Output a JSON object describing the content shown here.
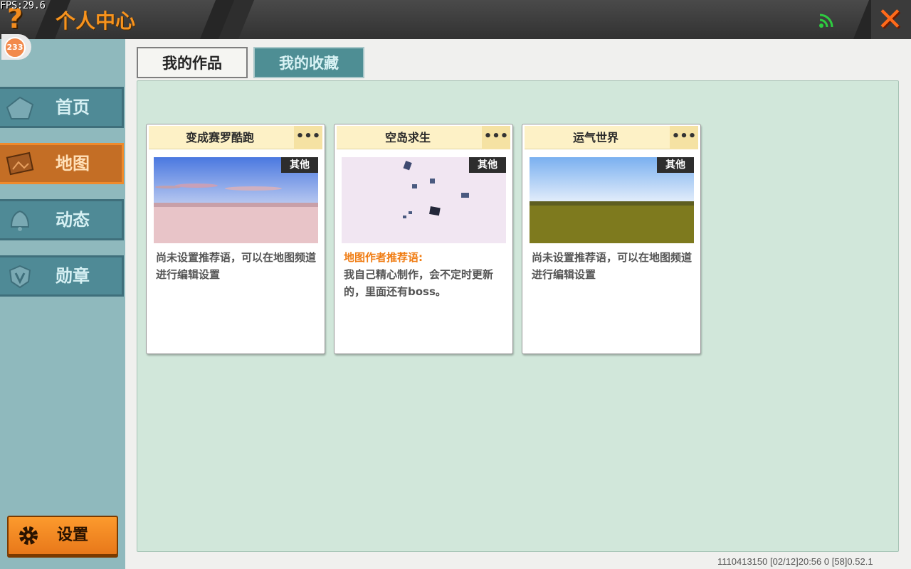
{
  "status": {
    "fps": "FPS:29.6"
  },
  "header": {
    "title": "个人中心",
    "help_icon": "?",
    "close_icon": "✕"
  },
  "badge": {
    "count": "233"
  },
  "sidebar": {
    "items": [
      {
        "label": "首页",
        "icon": "home-icon"
      },
      {
        "label": "地图",
        "icon": "map-icon",
        "active": true
      },
      {
        "label": "动态",
        "icon": "bell-icon"
      },
      {
        "label": "勋章",
        "icon": "medal-icon"
      }
    ],
    "settings_label": "设置"
  },
  "tabs": [
    {
      "label": "我的作品",
      "active": false
    },
    {
      "label": "我的收藏",
      "active": true
    }
  ],
  "cards": [
    {
      "name": "变成赛罗酷跑",
      "more": "•••",
      "tag": "其他",
      "desc_highlight": "",
      "desc": "尚未设置推荐语，可以在地图频道进行编辑设置"
    },
    {
      "name": "空岛求生",
      "more": "•••",
      "tag": "其他",
      "desc_highlight": "地图作者推荐语:",
      "desc": "我自己精心制作，会不定时更新的，里面还有boss。"
    },
    {
      "name": "运气世界",
      "more": "•••",
      "tag": "其他",
      "desc_highlight": "",
      "desc": "尚未设置推荐语，可以在地图频道进行编辑设置"
    }
  ],
  "footer": {
    "text": "1110413150   [02/12]20:56 0   [58]0.52.1"
  },
  "colors": {
    "accent": "#f7931e",
    "panel": "#d1e7da",
    "nav": "#4f8a96",
    "nav_active": "#c46e25"
  }
}
